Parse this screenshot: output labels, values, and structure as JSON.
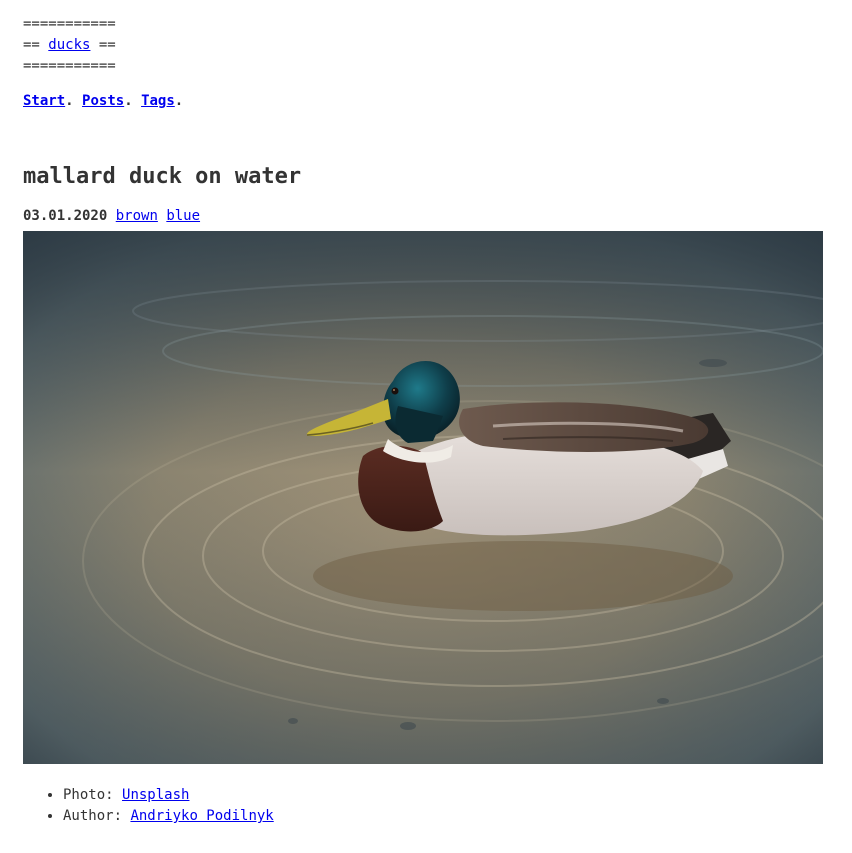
{
  "site": {
    "rule": "===========",
    "prefix": "== ",
    "name": "ducks",
    "suffix": " =="
  },
  "nav": {
    "items": [
      {
        "label": "Start"
      },
      {
        "label": "Posts"
      },
      {
        "label": "Tags"
      }
    ],
    "separator": ".",
    "end": "."
  },
  "post": {
    "title": "mallard duck on water",
    "date": "03.01.2020",
    "tags": [
      {
        "label": "brown"
      },
      {
        "label": "blue"
      }
    ],
    "image_alt": "mallard duck on water"
  },
  "credits": {
    "photo_label": "Photo: ",
    "photo_source": "Unsplash",
    "author_label": "Author: ",
    "author_name": "Andriyko Podilnyk"
  }
}
